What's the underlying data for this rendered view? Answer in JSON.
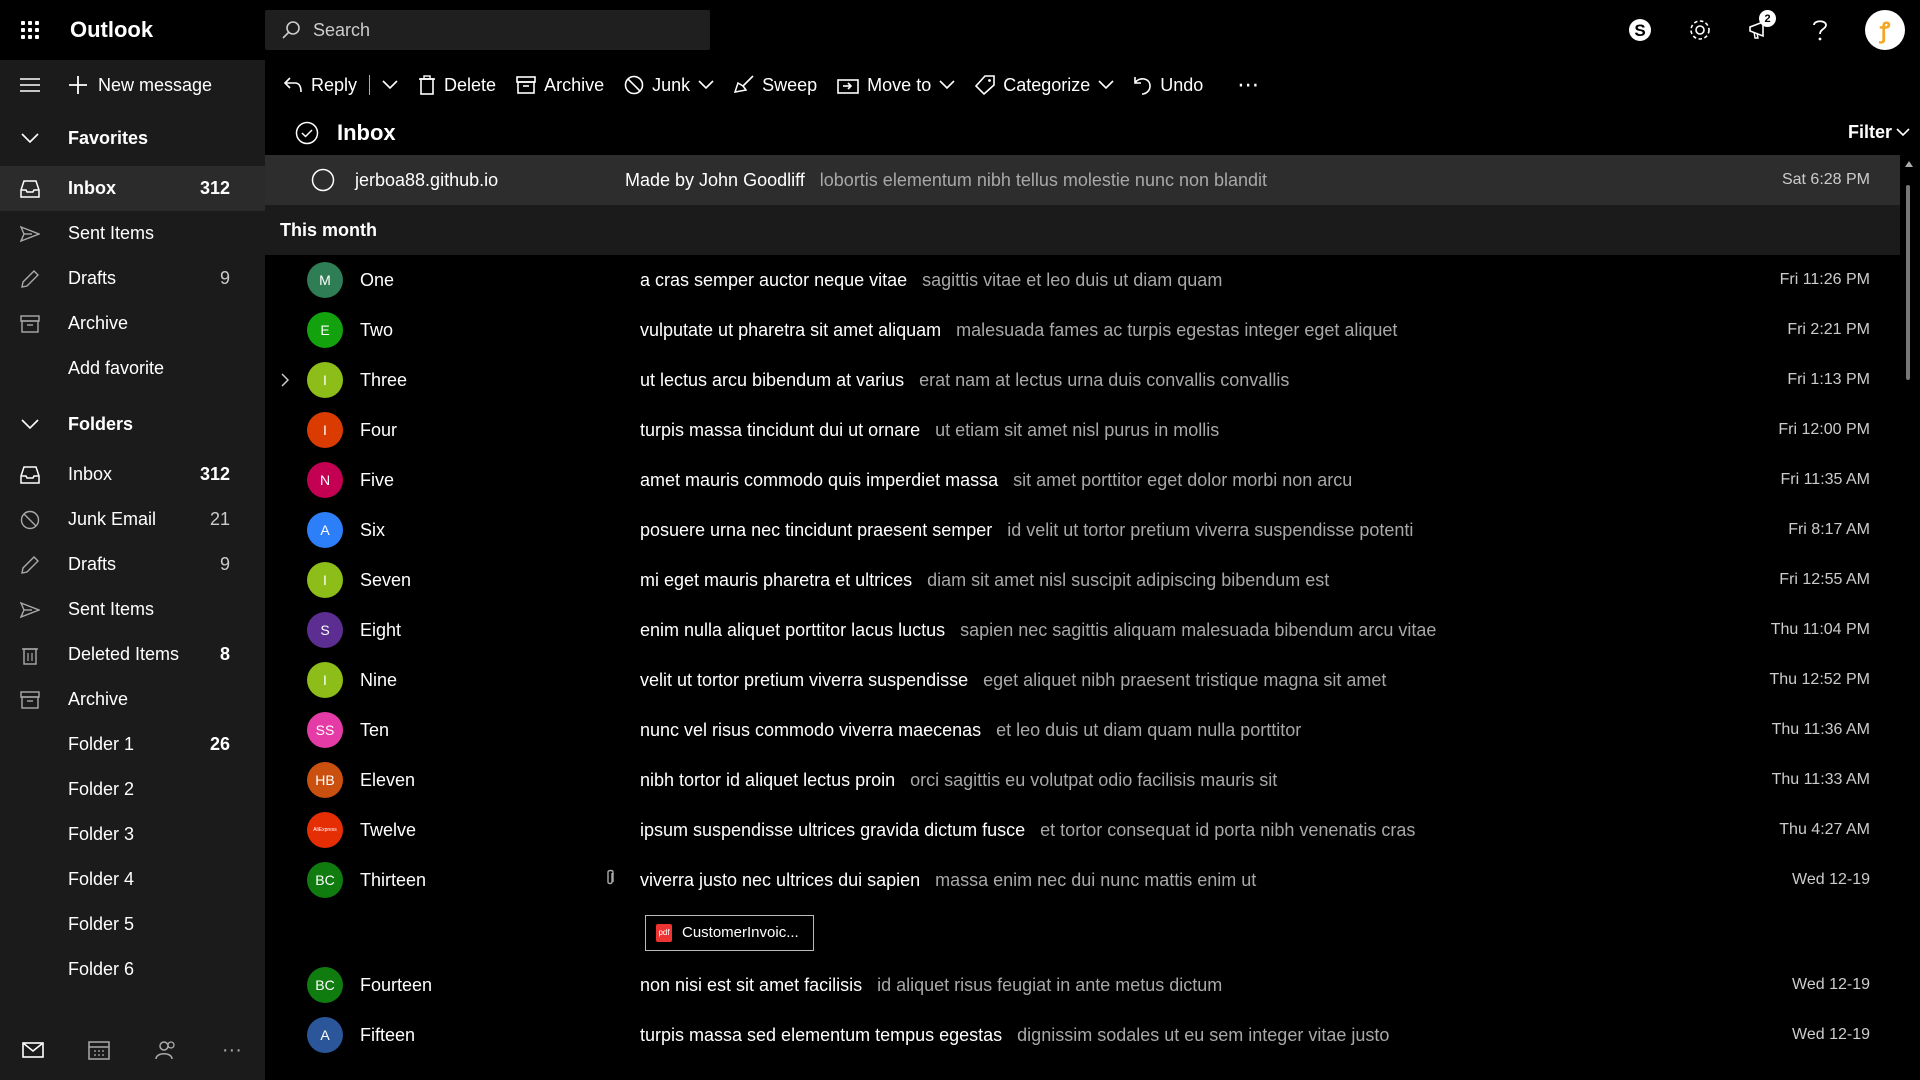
{
  "app": {
    "name": "Outlook"
  },
  "search": {
    "placeholder": "Search"
  },
  "top_right": {
    "notification_count": "2"
  },
  "sidebar": {
    "new_message": "New message",
    "favorites_header": "Favorites",
    "favorites": [
      {
        "label": "Inbox",
        "count": "312",
        "icon": "inbox-icon",
        "active": true
      },
      {
        "label": "Sent Items",
        "count": "",
        "icon": "send-icon"
      },
      {
        "label": "Drafts",
        "count": "9",
        "icon": "pencil-icon"
      },
      {
        "label": "Archive",
        "count": "",
        "icon": "archive-icon"
      },
      {
        "label": "Add favorite",
        "count": "",
        "icon": ""
      }
    ],
    "folders_header": "Folders",
    "folders": [
      {
        "label": "Inbox",
        "count": "312",
        "icon": "inbox-icon"
      },
      {
        "label": "Junk Email",
        "count": "21",
        "icon": "junk-icon"
      },
      {
        "label": "Drafts",
        "count": "9",
        "icon": "pencil-icon"
      },
      {
        "label": "Sent Items",
        "count": "",
        "icon": "send-icon"
      },
      {
        "label": "Deleted Items",
        "count": "8",
        "icon": "trash-icon"
      },
      {
        "label": "Archive",
        "count": "",
        "icon": "archive-icon"
      },
      {
        "label": "Folder 1",
        "count": "26",
        "icon": ""
      },
      {
        "label": "Folder 2",
        "count": "",
        "icon": ""
      },
      {
        "label": "Folder 3",
        "count": "",
        "icon": ""
      },
      {
        "label": "Folder 4",
        "count": "",
        "icon": ""
      },
      {
        "label": "Folder 5",
        "count": "",
        "icon": ""
      },
      {
        "label": "Folder 6",
        "count": "",
        "icon": ""
      }
    ]
  },
  "toolbar": {
    "reply": "Reply",
    "delete": "Delete",
    "archive": "Archive",
    "junk": "Junk",
    "sweep": "Sweep",
    "move_to": "Move to",
    "categorize": "Categorize",
    "undo": "Undo",
    "more": "⋯"
  },
  "list": {
    "title": "Inbox",
    "filter": "Filter",
    "pinned": {
      "sender": "jerboa88.github.io",
      "subject": "Made by John Goodliff",
      "preview": "lobortis elementum nibh tellus molestie nunc non blandit",
      "time": "Sat 6:28 PM"
    },
    "group": "This month",
    "messages": [
      {
        "initials": "M",
        "color": "#2e7d55",
        "sender": "One",
        "subject": "a cras semper auctor neque vitae",
        "preview": "sagittis vitae et leo duis ut diam quam",
        "time": "Fri 11:26 PM"
      },
      {
        "initials": "E",
        "color": "#13a10e",
        "sender": "Two",
        "subject": "vulputate ut pharetra sit amet aliquam",
        "preview": "malesuada fames ac turpis egestas integer eget aliquet",
        "time": "Fri 2:21 PM"
      },
      {
        "initials": "I",
        "color": "#8cbd18",
        "sender": "Three",
        "subject": "ut lectus arcu bibendum at varius",
        "preview": "erat nam at lectus urna duis convallis convallis",
        "time": "Fri 1:13 PM",
        "expandable": true
      },
      {
        "initials": "I",
        "color": "#da3b01",
        "sender": "Four",
        "subject": "turpis massa tincidunt dui ut ornare",
        "preview": "ut etiam sit amet nisl purus in mollis",
        "time": "Fri 12:00 PM"
      },
      {
        "initials": "N",
        "color": "#c30052",
        "sender": "Five",
        "subject": "amet mauris commodo quis imperdiet massa",
        "preview": "sit amet porttitor eget dolor morbi non arcu",
        "time": "Fri 11:35 AM"
      },
      {
        "initials": "A",
        "color": "#2d7ff9",
        "sender": "Six",
        "subject": "posuere urna nec tincidunt praesent semper",
        "preview": "id velit ut tortor pretium viverra suspendisse potenti",
        "time": "Fri 8:17 AM"
      },
      {
        "initials": "I",
        "color": "#8cbd18",
        "sender": "Seven",
        "subject": "mi eget mauris pharetra et ultrices",
        "preview": "diam sit amet nisl suscipit adipiscing bibendum est",
        "time": "Fri 12:55 AM"
      },
      {
        "initials": "S",
        "color": "#5c2e91",
        "sender": "Eight",
        "subject": "enim nulla aliquet porttitor lacus luctus",
        "preview": "sapien nec sagittis aliquam malesuada bibendum arcu vitae",
        "time": "Thu 11:04 PM"
      },
      {
        "initials": "I",
        "color": "#8cbd18",
        "sender": "Nine",
        "subject": "velit ut tortor pretium viverra suspendisse",
        "preview": "eget aliquet nibh praesent tristique magna sit amet",
        "time": "Thu 12:52 PM"
      },
      {
        "initials": "SS",
        "color": "#e43ba6",
        "sender": "Ten",
        "subject": "nunc vel risus commodo viverra maecenas",
        "preview": "et leo duis ut diam quam nulla porttitor",
        "time": "Thu 11:36 AM"
      },
      {
        "initials": "HB",
        "color": "#ca5010",
        "sender": "Eleven",
        "subject": "nibh tortor id aliquet lectus proin",
        "preview": "orci sagittis eu volutpat odio facilisis mauris sit",
        "time": "Thu 11:33 AM"
      },
      {
        "initials": "AliExpress",
        "color": "#e62e04",
        "sender": "Twelve",
        "subject": "ipsum suspendisse ultrices gravida dictum fusce",
        "preview": "et tortor consequat id porta nibh venenatis cras",
        "time": "Thu 4:27 AM"
      },
      {
        "initials": "BC",
        "color": "#107c10",
        "sender": "Thirteen",
        "subject": "viverra justo nec ultrices dui sapien",
        "preview": "massa enim nec dui nunc mattis enim ut",
        "time": "Wed 12-19",
        "attachment": true
      },
      {
        "initials": "BC",
        "color": "#107c10",
        "sender": "Fourteen",
        "subject": "non nisi est sit amet facilisis",
        "preview": "id aliquet risus feugiat in ante metus dictum",
        "time": "Wed 12-19"
      },
      {
        "initials": "A",
        "color": "#2b579a",
        "sender": "Fifteen",
        "subject": "turpis massa sed elementum tempus egestas",
        "preview": "dignissim sodales ut eu sem integer vitae justo",
        "time": "Wed 12-19"
      }
    ],
    "attachment_name": "CustomerInvoic..."
  }
}
